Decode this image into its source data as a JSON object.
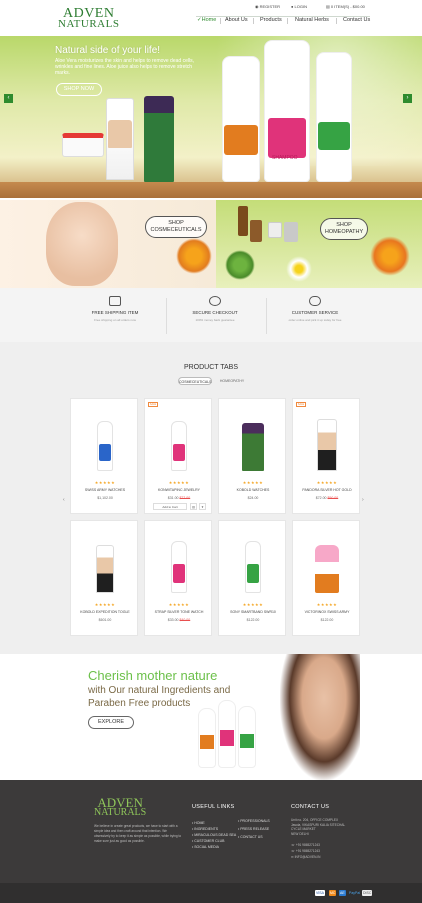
{
  "header": {
    "logo_top": "ADVEN",
    "logo_bottom": "NATURALS",
    "register": "REGISTER",
    "login": "LOGIN",
    "items": "0 ITEM(S) - $00.00",
    "nav": [
      "Home",
      "About Us",
      "Products",
      "Natural Herbs",
      "Contact Us"
    ]
  },
  "hero": {
    "title": "Natural side of your life!",
    "text": "Aloe Vera moisturizes the skin and helps to remove dead cells, wrinkles and fine lines. Aloe juice also helps to remove stretch marks.",
    "button": "SHOP NOW",
    "prev": "‹",
    "next": "›",
    "bottle_label": "SHAMPOO"
  },
  "promo": {
    "left": [
      "SHOP",
      "COSMECEUTICALS"
    ],
    "right": [
      "SHOP",
      "HOMEOPATHY"
    ]
  },
  "features": [
    {
      "title": "FREE SHIPPING ITEM",
      "sub": "Free shipping on all orders now"
    },
    {
      "title": "SECURE CHECKOUT",
      "sub": "100% money back guarantee"
    },
    {
      "title": "CUSTOMER SERVICE",
      "sub": "order online and pick it up today for free"
    }
  ],
  "product_tabs": {
    "title": "PRODUCT TABS",
    "tabs": [
      "COSMECEUTICALS",
      "HOMEOPATHY"
    ],
    "stars": "★★★★★",
    "sale": "SALE",
    "add_to_cart": "Add to Cart",
    "heart": "♥",
    "products": [
      {
        "name": "SWISS ARMY WATCHES",
        "price": "$1,102.00",
        "old": ""
      },
      {
        "name": "KONWITAPINC JEWELRY",
        "price": "$31.00",
        "old": "$72.00"
      },
      {
        "name": "KOBOLD WATCHES",
        "price": "$24.00",
        "old": ""
      },
      {
        "name": "PANDORA SILVER HOT GOLD",
        "price": "$72.00",
        "old": "$90.00"
      },
      {
        "name": "KOBOLD EXPEDITION TOGLE",
        "price": "$601.00",
        "old": ""
      },
      {
        "name": "STRAP SILVER TONE WATCH",
        "price": "$33.00",
        "old": "$40.00"
      },
      {
        "name": "SONY SMARTBAND SWR10",
        "price": "$122.00",
        "old": ""
      },
      {
        "name": "VICTORINOX SWISS ARMY",
        "price": "$122.00",
        "old": ""
      }
    ]
  },
  "banner": {
    "title": "Cherish mother nature",
    "line1": "with Our natural Ingredients and",
    "line2": "Paraben Free products",
    "button": "EXPLORE"
  },
  "footer": {
    "about": "We believe in create great products, we have to start with a simple idea and then craft around that intention. We obsessively try to keep it as simple as possible, while trying to make sure just as good as possible.",
    "useful_links_title": "USEFUL LINKS",
    "links_col1": [
      "HOME",
      "INGREDIENTS",
      "MIRACULOUS DEAD SEA",
      "CUSTOMER CLUB",
      "SOCIAL MEDIA"
    ],
    "links_col2": [
      "PROFESSIONALS",
      "PRESS RELEASE",
      "CONTACT US"
    ],
    "contact_title": "CONTACT US",
    "address": [
      "Unit no. 204, OFFICE COMPLEX",
      "Jasola, VIKASPURI KALIA SITECHAL",
      "CYCLE MARKET",
      "NEW DELHI"
    ],
    "phone1": "+91 9865271243",
    "phone2": "+91 9865271243",
    "email": "INFO@ADVEN.IN",
    "payments": [
      "VISA",
      "MC",
      "AE",
      "PayPal",
      "DISC"
    ]
  },
  "colors": {
    "green": "#2e8b2e",
    "accent": "#6cc04a",
    "footer": "#3c3a3a",
    "sale": "#f08a3e"
  }
}
